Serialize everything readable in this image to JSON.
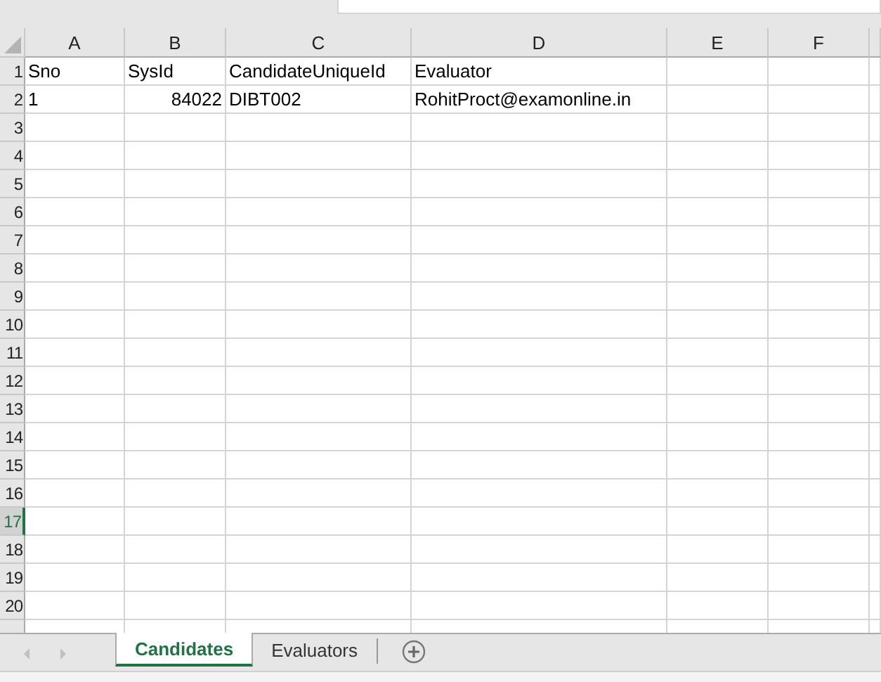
{
  "columns": [
    {
      "label": "A"
    },
    {
      "label": "B"
    },
    {
      "label": "C"
    },
    {
      "label": "D"
    },
    {
      "label": "E"
    },
    {
      "label": "F"
    }
  ],
  "rows": [
    {
      "number": "1",
      "selected": false,
      "cells": [
        {
          "value": "Sno",
          "kind": "text"
        },
        {
          "value": "SysId",
          "kind": "text"
        },
        {
          "value": "CandidateUniqueId",
          "kind": "text"
        },
        {
          "value": "Evaluator",
          "kind": "text"
        }
      ]
    },
    {
      "number": "2",
      "selected": false,
      "cells": [
        {
          "value": "1",
          "kind": "text"
        },
        {
          "value": "84022",
          "kind": "number"
        },
        {
          "value": "DIBT002",
          "kind": "text"
        },
        {
          "value": "RohitProct@examonline.in",
          "kind": "text"
        }
      ]
    },
    {
      "number": "3",
      "selected": false
    },
    {
      "number": "4",
      "selected": false
    },
    {
      "number": "5",
      "selected": false
    },
    {
      "number": "6",
      "selected": false
    },
    {
      "number": "7",
      "selected": false
    },
    {
      "number": "8",
      "selected": false
    },
    {
      "number": "9",
      "selected": false
    },
    {
      "number": "10",
      "selected": false
    },
    {
      "number": "11",
      "selected": false
    },
    {
      "number": "12",
      "selected": false
    },
    {
      "number": "13",
      "selected": false
    },
    {
      "number": "14",
      "selected": false
    },
    {
      "number": "15",
      "selected": false
    },
    {
      "number": "16",
      "selected": false
    },
    {
      "number": "17",
      "selected": true
    },
    {
      "number": "18",
      "selected": false
    },
    {
      "number": "19",
      "selected": false
    },
    {
      "number": "20",
      "selected": false
    }
  ],
  "sheet_tabs": [
    {
      "label": "Candidates",
      "selected": true
    },
    {
      "label": "Evaluators",
      "selected": false
    }
  ]
}
